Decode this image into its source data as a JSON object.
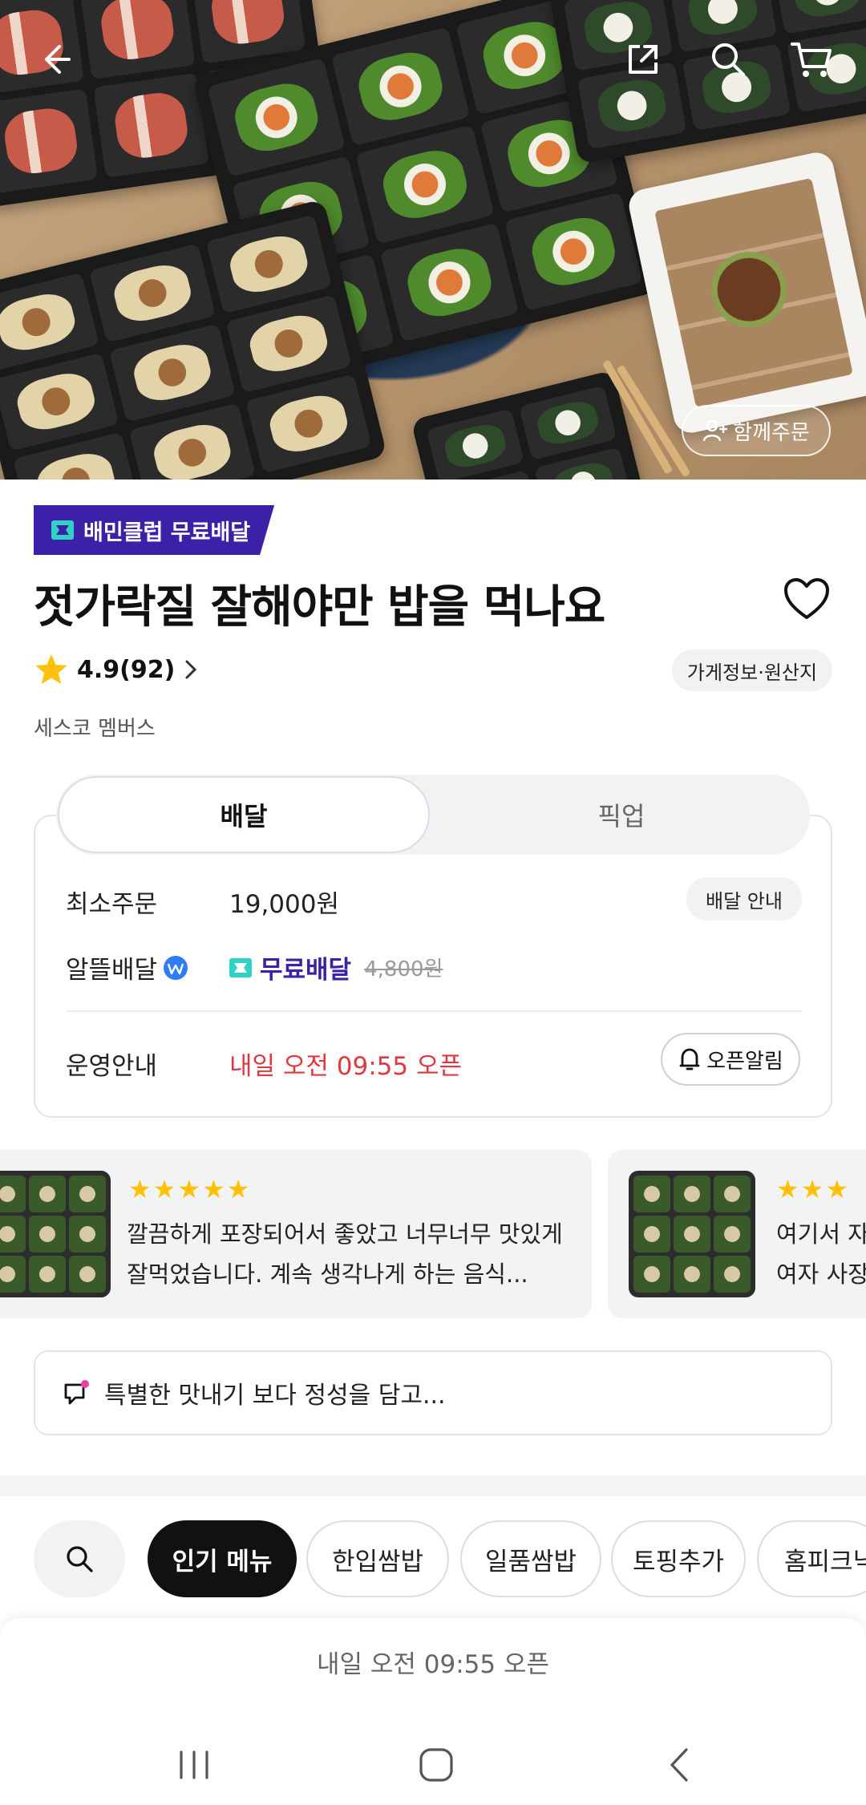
{
  "hero": {
    "together_label": "함께주문"
  },
  "store": {
    "badge": "배민클럽 무료배달",
    "title": "젓가락질 잘해야만 밥을 먹나요",
    "rating": "4.9(92)",
    "info_button": "가게정보·원산지",
    "subtitle": "세스코 멤버스"
  },
  "delivery": {
    "tabs": [
      "배달",
      "픽업"
    ],
    "min_order_label": "최소주문",
    "min_order_value": "19,000원",
    "guide_button": "배달 안내",
    "saver_label": "알뜰배달",
    "free_label": "무료배달",
    "original_fee": "4,800원",
    "hours_label": "운영안내",
    "hours_value": "내일 오전 09:55 오픈",
    "alarm_button": "오픈알림"
  },
  "reviews": [
    {
      "stars": "★★★★★",
      "line1": "깔끔하게 포장되어서 좋았고 너무너무  맛있게",
      "line2": "잘먹었습니다. 계속 생각나게 하는 음식..."
    },
    {
      "stars": "★★★",
      "line1": "여기서 자",
      "line2": "여자 사장"
    }
  ],
  "notice": "특별한 맛내기 보다 정성을 담고...",
  "categories": [
    "인기 메뉴",
    "한입쌈밥",
    "일품쌈밥",
    "토핑추가",
    "홈피크닉"
  ],
  "bottom": {
    "open_text": "내일 오전 09:55 오픈"
  },
  "colors": {
    "brand_purple": "#3d20a8",
    "mint": "#2fd2c4",
    "alert_red": "#e0383e",
    "star": "#ffc107"
  }
}
